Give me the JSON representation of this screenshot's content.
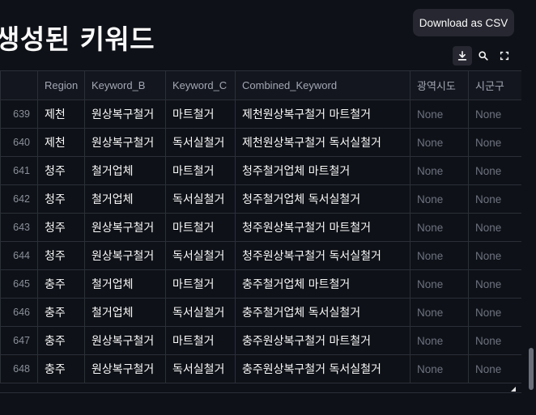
{
  "page": {
    "title": "생성된 키워드"
  },
  "tooltip": {
    "text": "Download as CSV"
  },
  "toolbar": {
    "buttons": [
      {
        "name": "download-button",
        "icon": "download-icon"
      },
      {
        "name": "search-button",
        "icon": "search-icon"
      },
      {
        "name": "fullscreen-button",
        "icon": "fullscreen-icon"
      }
    ]
  },
  "table": {
    "columns": [
      "Region",
      "Keyword_B",
      "Keyword_C",
      "Combined_Keyword",
      "광역시도",
      "시군구"
    ],
    "rows": [
      {
        "index": "639",
        "region": "제천",
        "keyword_b": "원상복구철거",
        "keyword_c": "마트철거",
        "combined": "제천원상복구철거 마트철거",
        "province": "None",
        "district": "None"
      },
      {
        "index": "640",
        "region": "제천",
        "keyword_b": "원상복구철거",
        "keyword_c": "독서실철거",
        "combined": "제천원상복구철거 독서실철거",
        "province": "None",
        "district": "None"
      },
      {
        "index": "641",
        "region": "청주",
        "keyword_b": "철거업체",
        "keyword_c": "마트철거",
        "combined": "청주철거업체 마트철거",
        "province": "None",
        "district": "None"
      },
      {
        "index": "642",
        "region": "청주",
        "keyword_b": "철거업체",
        "keyword_c": "독서실철거",
        "combined": "청주철거업체 독서실철거",
        "province": "None",
        "district": "None"
      },
      {
        "index": "643",
        "region": "청주",
        "keyword_b": "원상복구철거",
        "keyword_c": "마트철거",
        "combined": "청주원상복구철거 마트철거",
        "province": "None",
        "district": "None"
      },
      {
        "index": "644",
        "region": "청주",
        "keyword_b": "원상복구철거",
        "keyword_c": "독서실철거",
        "combined": "청주원상복구철거 독서실철거",
        "province": "None",
        "district": "None"
      },
      {
        "index": "645",
        "region": "충주",
        "keyword_b": "철거업체",
        "keyword_c": "마트철거",
        "combined": "충주철거업체 마트철거",
        "province": "None",
        "district": "None"
      },
      {
        "index": "646",
        "region": "충주",
        "keyword_b": "철거업체",
        "keyword_c": "독서실철거",
        "combined": "충주철거업체 독서실철거",
        "province": "None",
        "district": "None"
      },
      {
        "index": "647",
        "region": "충주",
        "keyword_b": "원상복구철거",
        "keyword_c": "마트철거",
        "combined": "충주원상복구철거 마트철거",
        "province": "None",
        "district": "None"
      },
      {
        "index": "648",
        "region": "충주",
        "keyword_b": "원상복구철거",
        "keyword_c": "독서실철거",
        "combined": "충주원상복구철거 독서실철거",
        "province": "None",
        "district": "None"
      }
    ]
  }
}
